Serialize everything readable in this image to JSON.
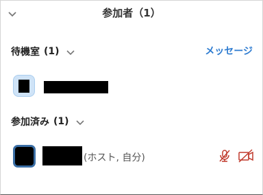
{
  "header": {
    "title": "参加者（1）"
  },
  "waiting_room": {
    "title": "待機室",
    "count": "(1)",
    "message_link": "メッセージ"
  },
  "joined": {
    "title": "参加済み",
    "count": "(1)",
    "participant_role": "(ホスト, 自分)"
  },
  "colors": {
    "accent_link": "#2d7bd0",
    "muted_icon": "#c0392b",
    "avatar_border": "#3a6ea5"
  },
  "icons": {
    "collapse": "chevron-down-icon",
    "mic": "mic-muted-icon",
    "video": "video-off-icon"
  }
}
